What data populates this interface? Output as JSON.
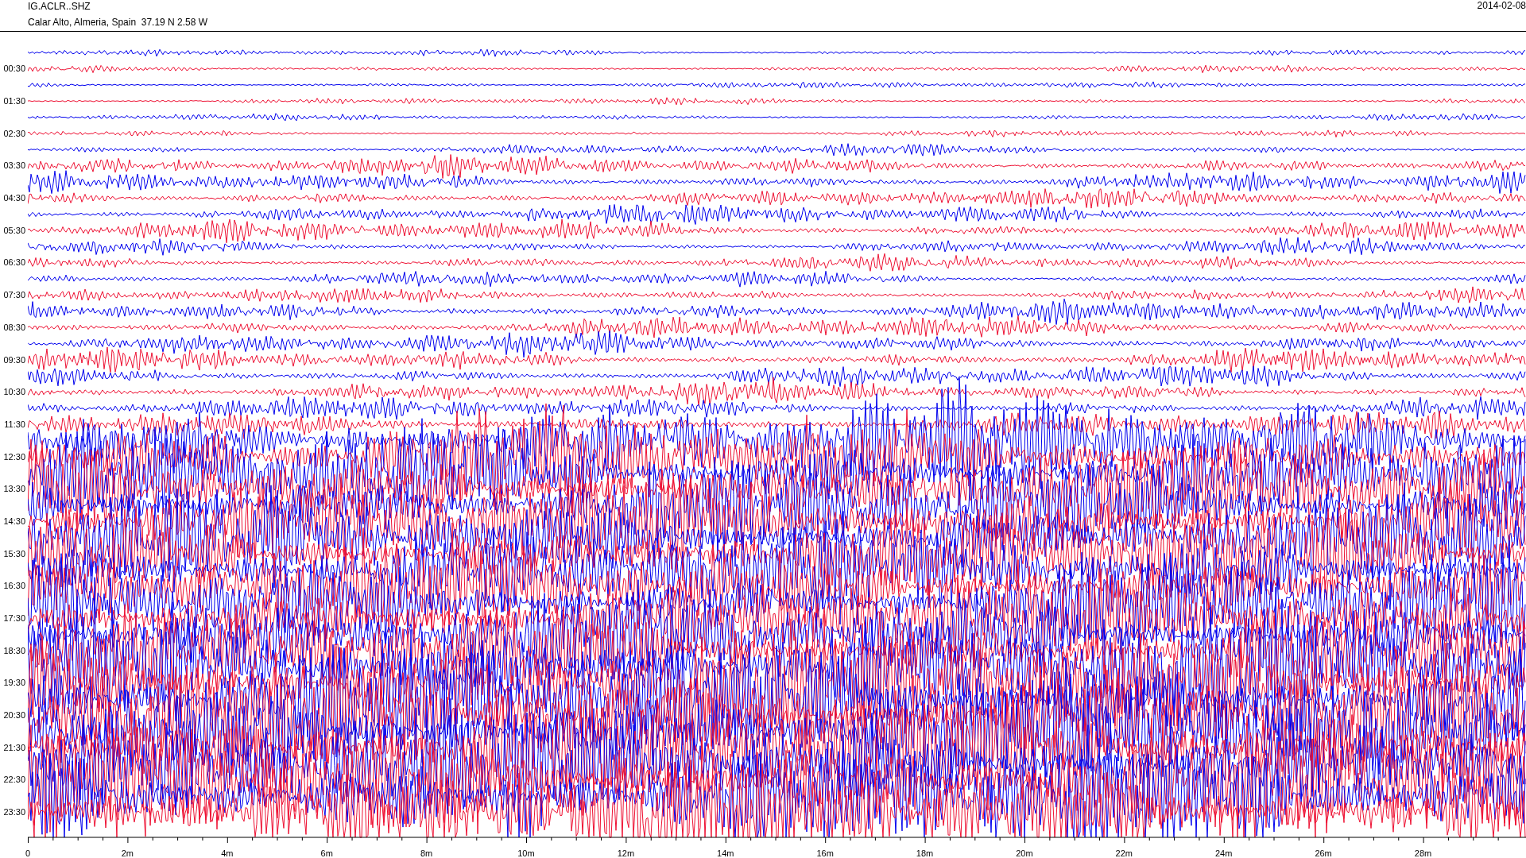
{
  "header": {
    "station": "IG.ACLR..SHZ",
    "location": "Calar Alto, Almeria, Spain  37.19 N 2.58 W",
    "date": "2014-02-08"
  },
  "hour_labels": [
    "00:30",
    "01:30",
    "02:30",
    "03:30",
    "04:30",
    "05:30",
    "06:30",
    "07:30",
    "08:30",
    "09:30",
    "10:30",
    "11:30",
    "12:30",
    "13:30",
    "14:30",
    "15:30",
    "16:30",
    "17:30",
    "18:30",
    "19:30",
    "20:30",
    "21:30",
    "22:30",
    "23:30"
  ],
  "x_axis_labels": [
    "0",
    "2m",
    "4m",
    "6m",
    "8m",
    "10m",
    "12m",
    "14m",
    "16m",
    "18m",
    "20m",
    "22m",
    "24m",
    "26m",
    "28m"
  ]
}
